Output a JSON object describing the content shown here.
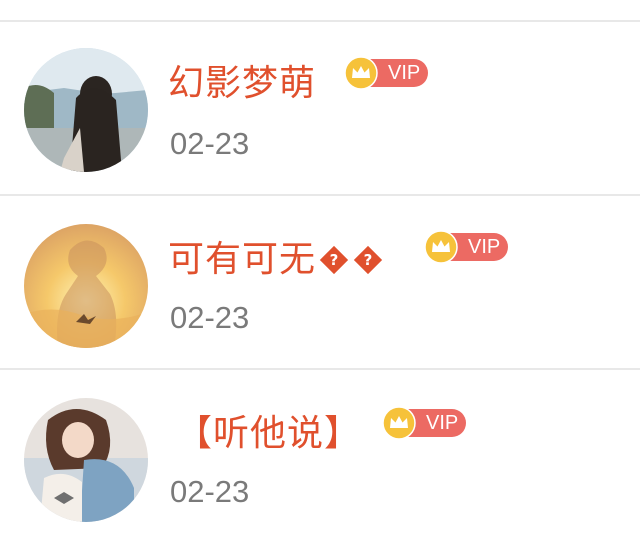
{
  "comments": [
    {
      "username": "幻影梦萌",
      "badge": "VIP",
      "date": "02-23",
      "avatar": "girl-by-sea-photo",
      "name_suffix_icons": []
    },
    {
      "username": "可有可无",
      "badge": "VIP",
      "date": "02-23",
      "avatar": "silhouette-sunset-photo",
      "name_suffix_icons": [
        "?",
        "?"
      ]
    },
    {
      "username": "【听他说】",
      "badge": "VIP",
      "date": "02-23",
      "avatar": "girl-denim-jacket-photo",
      "name_suffix_icons": []
    }
  ],
  "colors": {
    "username": "#e0502d",
    "date": "#7a7a7a",
    "vip_pill": "#ec6a63",
    "vip_coin": "#f6c23a",
    "divider": "#e8e8e8"
  }
}
